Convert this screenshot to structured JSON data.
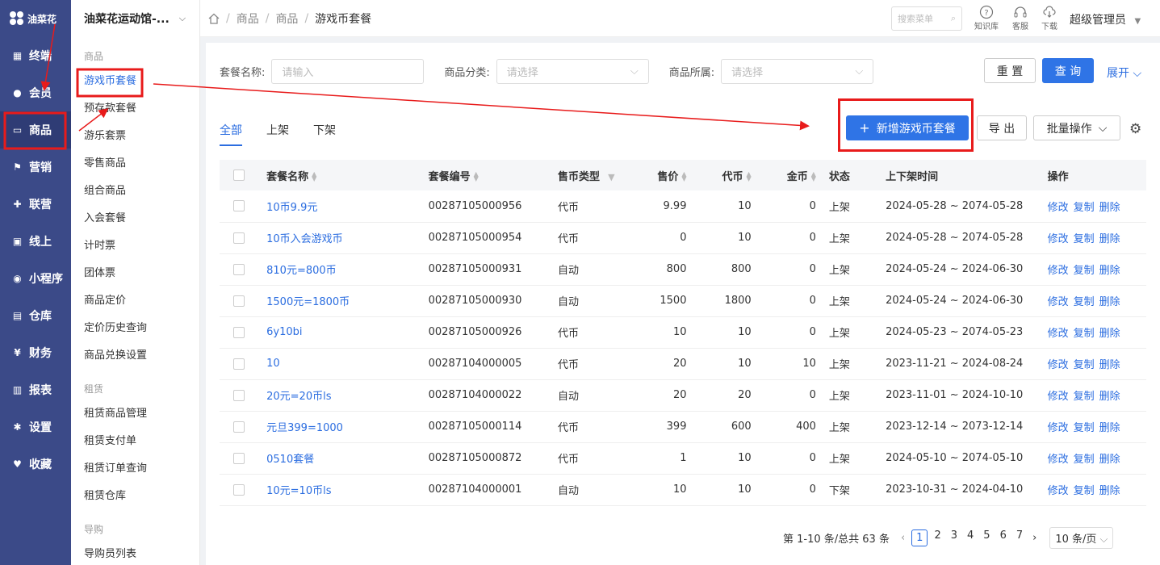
{
  "brand": "油菜花",
  "nav": [
    {
      "label": "终端",
      "icon": "terminal-icon",
      "glyph": "▦"
    },
    {
      "label": "会员",
      "icon": "member-icon",
      "glyph": "●"
    },
    {
      "label": "商品",
      "icon": "product-icon",
      "glyph": "▭"
    },
    {
      "label": "营销",
      "icon": "flag-icon",
      "glyph": "⚑"
    },
    {
      "label": "联营",
      "icon": "gift-icon",
      "glyph": "✚"
    },
    {
      "label": "线上",
      "icon": "window-icon",
      "glyph": "▣"
    },
    {
      "label": "小程序",
      "icon": "miniapp-icon",
      "glyph": "◉"
    },
    {
      "label": "仓库",
      "icon": "warehouse-icon",
      "glyph": "▤"
    },
    {
      "label": "财务",
      "icon": "yen-icon",
      "glyph": "¥"
    },
    {
      "label": "报表",
      "icon": "report-icon",
      "glyph": "▥"
    },
    {
      "label": "设置",
      "icon": "gear-icon",
      "glyph": "✱"
    },
    {
      "label": "收藏",
      "icon": "heart-icon",
      "glyph": "♥"
    }
  ],
  "store": "油菜花运动馆-...",
  "submenu": {
    "g1": "商品",
    "items1": [
      "游戏币套餐",
      "预存款套餐",
      "游乐套票",
      "零售商品",
      "组合商品",
      "入会套餐",
      "计时票",
      "团体票",
      "商品定价",
      "定价历史查询",
      "商品兑换设置"
    ],
    "g2": "租赁",
    "items2": [
      "租赁商品管理",
      "租赁支付单",
      "租赁订单查询",
      "租赁仓库"
    ],
    "g3": "导购",
    "items3": [
      "导购员列表"
    ]
  },
  "breadcrumb": [
    "商品",
    "商品",
    "游戏币套餐"
  ],
  "header": {
    "search_placeholder": "搜索菜单",
    "knowledge": "知识库",
    "service": "客服",
    "download": "下载",
    "user": "超级管理员"
  },
  "filters": {
    "name_label": "套餐名称:",
    "name_placeholder": "请输入",
    "cat_label": "商品分类:",
    "cat_placeholder": "请选择",
    "owner_label": "商品所属:",
    "owner_placeholder": "请选择",
    "reset": "重 置",
    "query": "查 询",
    "expand": "展开"
  },
  "tabs": [
    "全部",
    "上架",
    "下架"
  ],
  "actions": {
    "add": "新增游戏币套餐",
    "export": "导 出",
    "batch": "批量操作"
  },
  "columns": [
    "套餐名称",
    "套餐编号",
    "售币类型",
    "售价",
    "代币",
    "金币",
    "状态",
    "上下架时间",
    "操作"
  ],
  "rows": [
    [
      "10币9.9元",
      "00287105000956",
      "代币",
      "9.99",
      "10",
      "0",
      "上架",
      "2024-05-28 ~ 2074-05-28"
    ],
    [
      "10币入会游戏币",
      "00287105000954",
      "代币",
      "0",
      "10",
      "0",
      "上架",
      "2024-05-28 ~ 2074-05-28"
    ],
    [
      "810元=800币",
      "00287105000931",
      "自动",
      "800",
      "800",
      "0",
      "上架",
      "2024-05-24 ~ 2024-06-30"
    ],
    [
      "1500元=1800币",
      "00287105000930",
      "自动",
      "1500",
      "1800",
      "0",
      "上架",
      "2024-05-24 ~ 2024-06-30"
    ],
    [
      "6y10bi",
      "00287105000926",
      "代币",
      "10",
      "10",
      "0",
      "上架",
      "2024-05-23 ~ 2074-05-23"
    ],
    [
      "10",
      "00287104000005",
      "代币",
      "20",
      "10",
      "10",
      "上架",
      "2023-11-21 ~ 2024-08-24"
    ],
    [
      "20元=20币ls",
      "00287104000022",
      "自动",
      "20",
      "20",
      "0",
      "上架",
      "2023-11-01 ~ 2024-10-10"
    ],
    [
      "元旦399=1000",
      "00287105000114",
      "代币",
      "399",
      "600",
      "400",
      "上架",
      "2023-12-14 ~ 2073-12-14"
    ],
    [
      "0510套餐",
      "00287105000872",
      "代币",
      "1",
      "10",
      "0",
      "上架",
      "2024-05-10 ~ 2074-05-10"
    ],
    [
      "10元=10币ls",
      "00287104000001",
      "自动",
      "10",
      "10",
      "0",
      "下架",
      "2023-10-31 ~ 2024-04-10"
    ]
  ],
  "ops": [
    "修改",
    "复制",
    "删除"
  ],
  "pager": {
    "summary": "第 1-10 条/总共 63 条",
    "pages": [
      "1",
      "2",
      "3",
      "4",
      "5",
      "6",
      "7"
    ],
    "size": "10 条/页"
  },
  "colors": {
    "nav": "#3b4a88",
    "accent": "#2b6de0",
    "annot": "#e81b1b"
  }
}
